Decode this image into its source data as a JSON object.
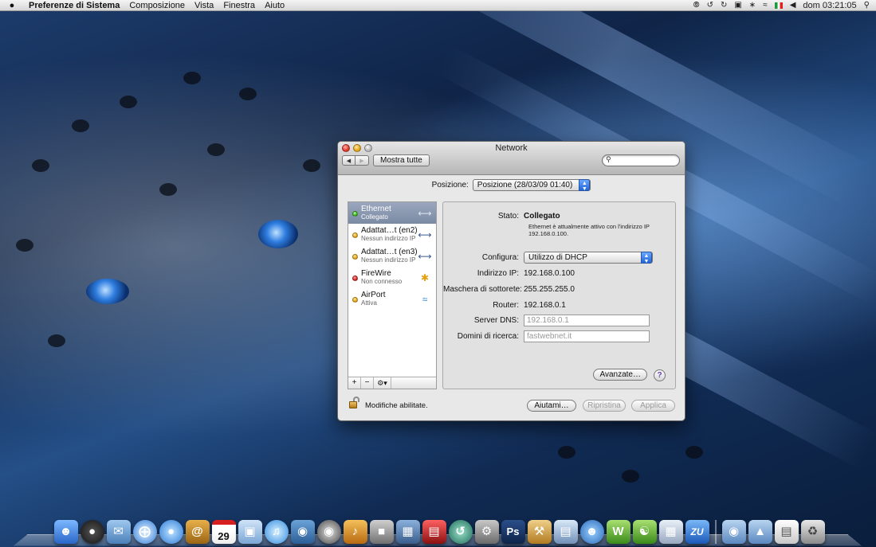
{
  "menubar": {
    "apple_icon": "apple-icon",
    "items": [
      "Preferenze di Sistema",
      "Composizione",
      "Vista",
      "Finestra",
      "Aiuto"
    ],
    "clock": "dom 03:21:05"
  },
  "window": {
    "title": "Network",
    "show_all": "Mostra tutte",
    "search_placeholder": "",
    "position_label": "Posizione:",
    "position_value": "Posizione (28/03/09 01:40)"
  },
  "services": [
    {
      "name": "Ethernet",
      "status": "Collegato",
      "dot": "green",
      "icon": "ethernet-icon"
    },
    {
      "name": "Adattat…t (en2)",
      "status": "Nessun indirizzo IP",
      "dot": "yellow",
      "icon": "ethernet-arrows-icon"
    },
    {
      "name": "Adattat…t (en3)",
      "status": "Nessun indirizzo IP",
      "dot": "yellow",
      "icon": "ethernet-arrows-icon"
    },
    {
      "name": "FireWire",
      "status": "Non connesso",
      "dot": "red",
      "icon": "firewire-icon"
    },
    {
      "name": "AirPort",
      "status": "Attiva",
      "dot": "yellow",
      "icon": "wifi-icon"
    }
  ],
  "sidebar_toolbar": {
    "add": "+",
    "remove": "−",
    "gear": "⚙▾"
  },
  "detail": {
    "stato_label": "Stato:",
    "stato_value": "Collegato",
    "stato_desc": "Ethernet è attualmente attivo con l'indirizzo IP 192.168.0.100.",
    "configura_label": "Configura:",
    "configura_value": "Utilizzo di DHCP",
    "ip_label": "Indirizzo IP:",
    "ip_value": "192.168.0.100",
    "mask_label": "Maschera di sottorete:",
    "mask_value": "255.255.255.0",
    "router_label": "Router:",
    "router_value": "192.168.0.1",
    "dns_label": "Server DNS:",
    "dns_value": "192.168.0.1",
    "domains_label": "Domini di ricerca:",
    "domains_value": "fastwebnet.it",
    "advanced_button": "Avanzate…",
    "help": "?"
  },
  "bottom": {
    "lock_text": "Modifiche abilitate.",
    "help_button": "Aiutami…",
    "revert_button": "Ripristina",
    "apply_button": "Applica"
  },
  "dock": {
    "apps": [
      "finder",
      "dashboard",
      "mail",
      "safari",
      "ichat",
      "address-book",
      "ical",
      "preview",
      "itunes",
      "iphoto",
      "dvd-player",
      "garageband",
      "photo-booth",
      "exposé",
      "photo-strip",
      "time-machine",
      "system-preferences",
      "photoshop",
      "toolbox",
      "ip-scanner",
      "users",
      "dreamweaver",
      "network",
      "utility",
      "zu",
      "documents",
      "downloads",
      "stack",
      "trash"
    ],
    "calendar_day": "29",
    "photoshop_label": "Ps",
    "zu_label": "ZU"
  },
  "colors": {
    "accent": "#2165d8",
    "selected_row": "#8594ad"
  }
}
